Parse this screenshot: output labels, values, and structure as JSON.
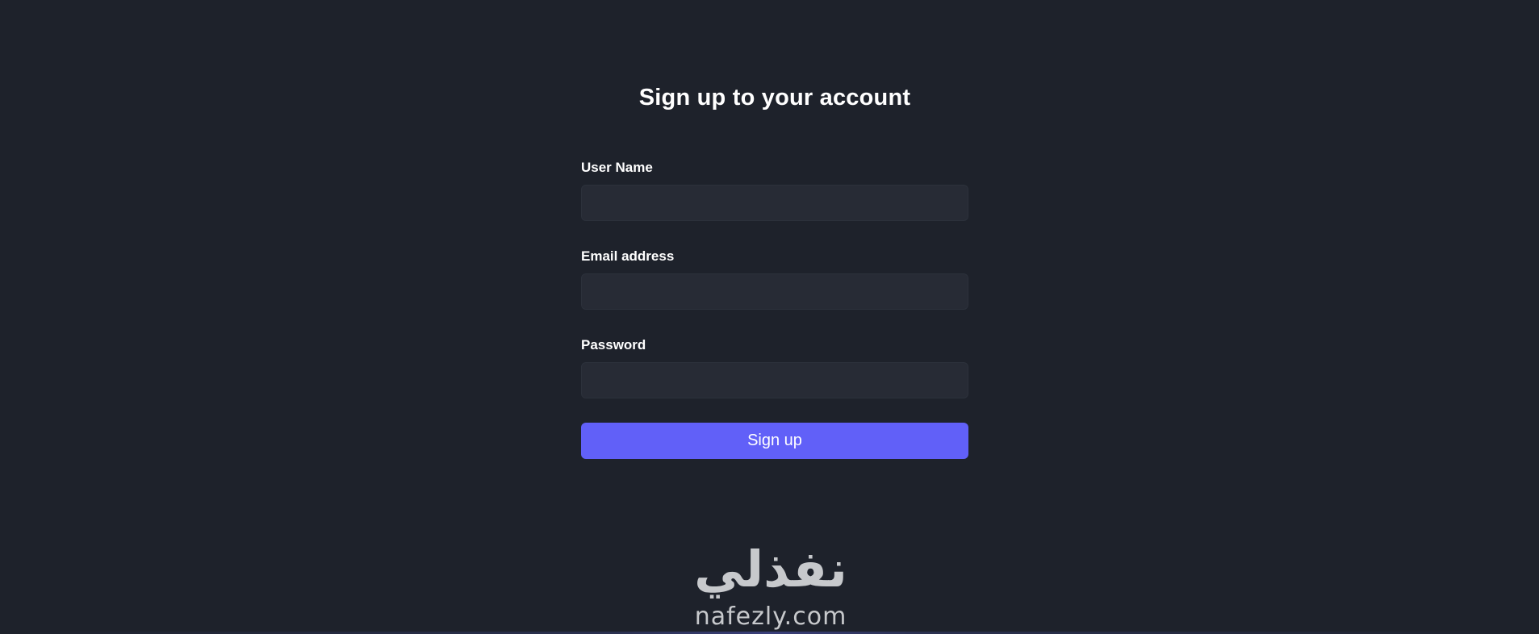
{
  "form": {
    "title": "Sign up to your account",
    "fields": [
      {
        "label": "User Name",
        "value": "",
        "placeholder": ""
      },
      {
        "label": "Email address",
        "value": "",
        "placeholder": ""
      },
      {
        "label": "Password",
        "value": "",
        "placeholder": ""
      }
    ],
    "submit_label": "Sign up"
  },
  "watermark": {
    "arabic": "نفذلي",
    "latin": "nafezly.com"
  },
  "colors": {
    "background": "#1e222b",
    "input_background": "#272b35",
    "accent": "#6160f8",
    "text": "#ffffff"
  }
}
